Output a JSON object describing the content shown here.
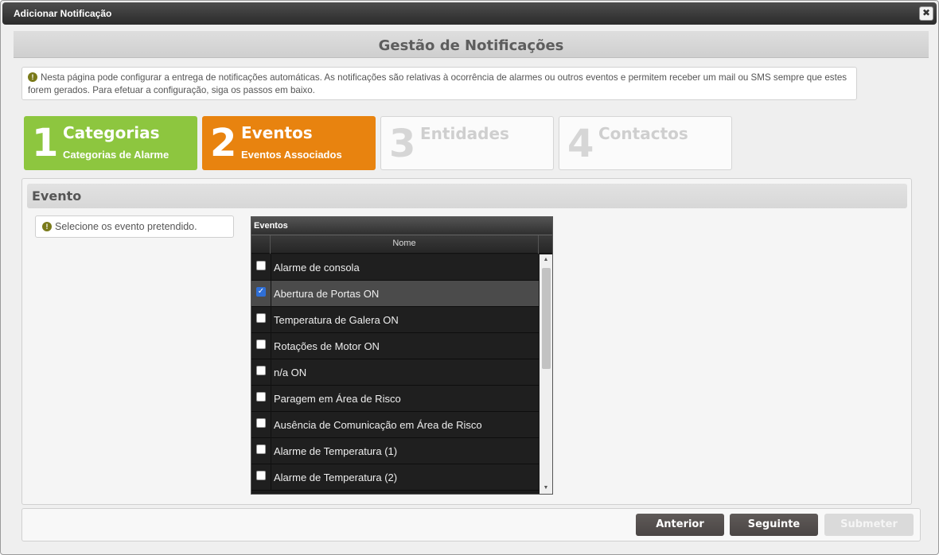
{
  "window": {
    "title": "Adicionar Notificação",
    "close_icon": "close-icon"
  },
  "page": {
    "heading": "Gestão de Notificações"
  },
  "info": {
    "icon": "info-icon",
    "text": "Nesta página pode configurar a entrega de notificações automáticas. As notificações são relativas à ocorrência de alarmes ou outros eventos e permitem receber um mail ou SMS sempre que estes forem gerados. Para efetuar a configuração, siga os passos em baixo."
  },
  "steps": [
    {
      "num": "1",
      "title": "Categorias",
      "subtitle": "Categorias de Alarme",
      "state": "done",
      "color": "#8dc63f"
    },
    {
      "num": "2",
      "title": "Eventos",
      "subtitle": "Eventos Associados",
      "state": "active",
      "color": "#e8830f"
    },
    {
      "num": "3",
      "title": "Entidades",
      "subtitle": "",
      "state": "disabled"
    },
    {
      "num": "4",
      "title": "Contactos",
      "subtitle": "",
      "state": "disabled"
    }
  ],
  "section": {
    "title": "Evento",
    "hint": "Selecione os evento pretendido."
  },
  "grid": {
    "caption": "Eventos",
    "column": "Nome",
    "rows": [
      {
        "label": "Alarme de consola",
        "checked": false
      },
      {
        "label": "Abertura de Portas ON",
        "checked": true
      },
      {
        "label": "Temperatura de Galera ON",
        "checked": false
      },
      {
        "label": "Rotações de Motor ON",
        "checked": false
      },
      {
        "label": "n/a ON",
        "checked": false
      },
      {
        "label": "Paragem em Área de Risco",
        "checked": false
      },
      {
        "label": "Ausência de Comunicação em Área de Risco",
        "checked": false
      },
      {
        "label": "Alarme de Temperatura (1)",
        "checked": false
      },
      {
        "label": "Alarme de Temperatura (2)",
        "checked": false
      }
    ]
  },
  "footer": {
    "prev": "Anterior",
    "next": "Seguinte",
    "submit": "Submeter"
  }
}
